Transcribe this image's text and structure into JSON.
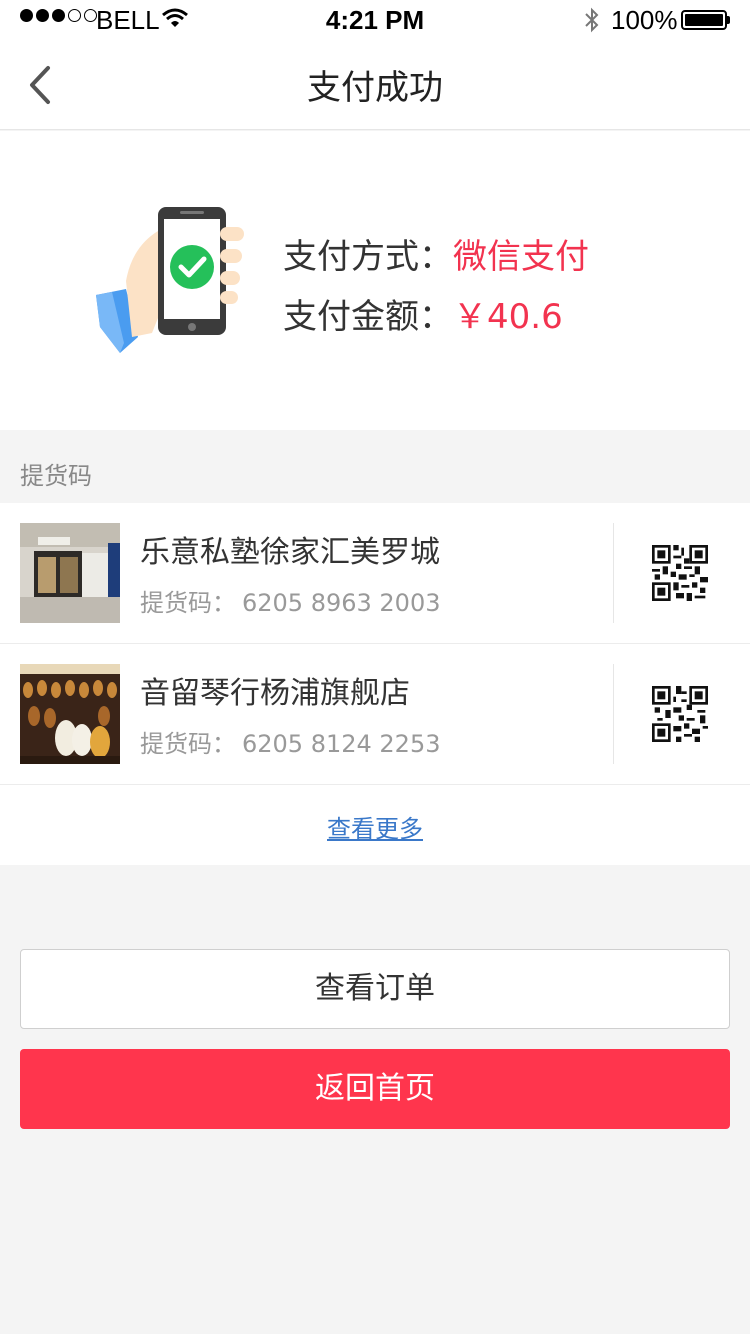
{
  "status_bar": {
    "carrier": "BELL",
    "time": "4:21 PM",
    "battery": "100%"
  },
  "navbar": {
    "title": "支付成功"
  },
  "payment": {
    "method_label": "支付方式：",
    "method_value": "微信支付",
    "amount_label": "支付金额：",
    "amount_value": "￥40.6"
  },
  "pickup": {
    "section_title": "提货码",
    "stores": [
      {
        "name": "乐意私塾徐家汇美罗城",
        "code_label": "提货码：",
        "code": "6205 8963 2003"
      },
      {
        "name": "音留琴行杨浦旗舰店",
        "code_label": "提货码：",
        "code": "6205 8124 2253"
      }
    ],
    "more_label": "查看更多"
  },
  "actions": {
    "view_order": "查看订单",
    "back_home": "返回首页"
  },
  "colors": {
    "accent": "#ff354d",
    "price": "#f2334f",
    "link": "#3a78c9"
  }
}
